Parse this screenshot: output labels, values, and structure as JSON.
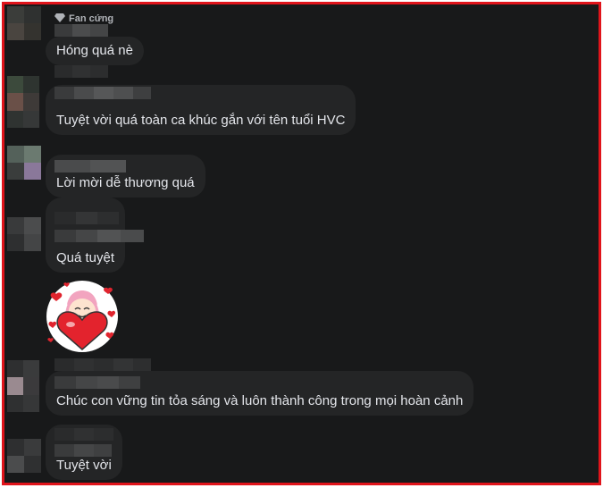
{
  "comments": [
    {
      "text": "Hóng quá nè",
      "badge": "Fan cứng"
    },
    {
      "text": "Tuyệt vời quá toàn ca khúc gắn với tên tuổi HVC"
    },
    {
      "text": "Lời mời dễ thương quá"
    },
    {
      "text": "Quá tuyệt"
    },
    {
      "text": "Chúc con vững tin tỏa sáng và luôn thành công trong mọi hoàn cảnh"
    },
    {
      "text": "Tuyệt vời"
    }
  ],
  "sticker": {
    "icon": "heart-hug-sticker-icon"
  },
  "badge_icon": "diamond-icon",
  "colors": {
    "background": "#18191a",
    "bubble": "#242526",
    "text": "#e4e6eb",
    "frame": "#e0141b"
  }
}
